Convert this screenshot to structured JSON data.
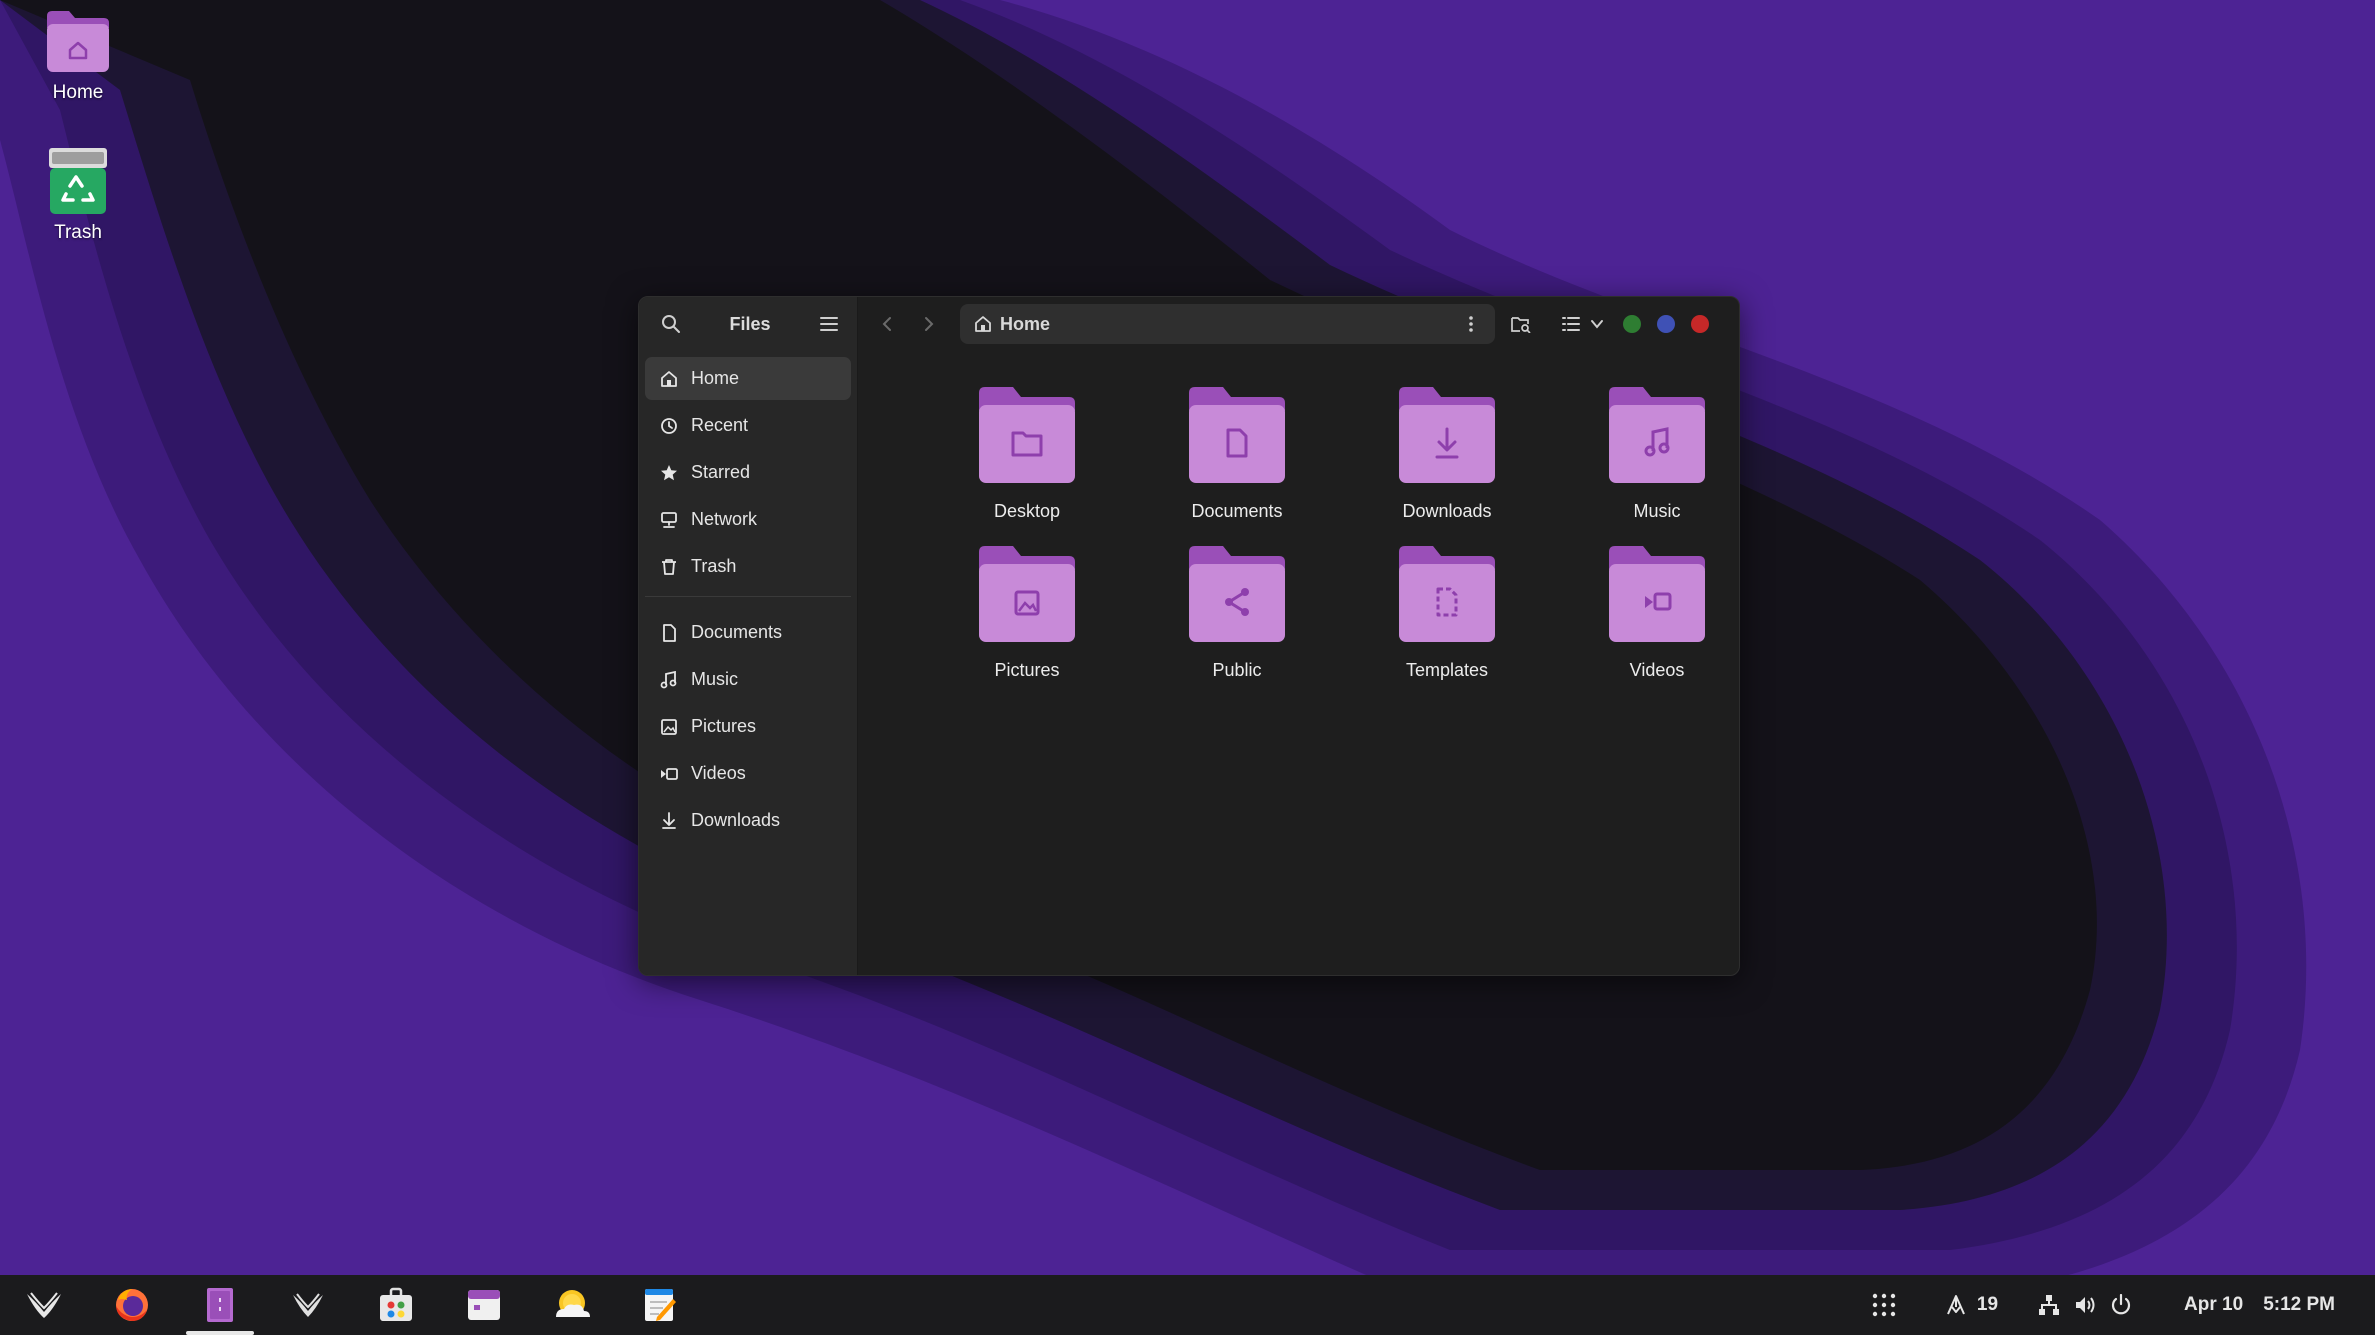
{
  "desktop": {
    "icons": [
      {
        "label": "Home",
        "icon": "home-folder-icon"
      },
      {
        "label": "Trash",
        "icon": "trash-icon"
      }
    ]
  },
  "window": {
    "sidebar": {
      "title": "Files",
      "places": [
        {
          "label": "Home",
          "icon": "home-icon",
          "active": true
        },
        {
          "label": "Recent",
          "icon": "clock-icon"
        },
        {
          "label": "Starred",
          "icon": "star-icon"
        },
        {
          "label": "Network",
          "icon": "network-icon"
        },
        {
          "label": "Trash",
          "icon": "trash-icon"
        }
      ],
      "bookmarks": [
        {
          "label": "Documents",
          "icon": "document-icon"
        },
        {
          "label": "Music",
          "icon": "music-icon"
        },
        {
          "label": "Pictures",
          "icon": "image-icon"
        },
        {
          "label": "Videos",
          "icon": "video-icon"
        },
        {
          "label": "Downloads",
          "icon": "download-icon"
        }
      ]
    },
    "path": {
      "label": "Home",
      "icon": "home-icon"
    },
    "folders": [
      {
        "label": "Desktop",
        "icon": "folder-glyph"
      },
      {
        "label": "Documents",
        "icon": "document-glyph"
      },
      {
        "label": "Downloads",
        "icon": "download-glyph"
      },
      {
        "label": "Music",
        "icon": "music-glyph"
      },
      {
        "label": "Pictures",
        "icon": "image-glyph"
      },
      {
        "label": "Public",
        "icon": "share-glyph"
      },
      {
        "label": "Templates",
        "icon": "template-glyph"
      },
      {
        "label": "Videos",
        "icon": "video-glyph"
      }
    ],
    "colors": {
      "folder_body": "#c88ad8",
      "folder_tab": "#9a4fb8",
      "glyph": "#8e3fac"
    },
    "window_controls": [
      {
        "name": "minimize",
        "color": "#2e7d32"
      },
      {
        "name": "maximize",
        "color": "#3f51b5"
      },
      {
        "name": "close",
        "color": "#c62828"
      }
    ]
  },
  "taskbar": {
    "apps": [
      "launcher",
      "firefox",
      "files",
      "zorin-connect",
      "software-store",
      "calendar",
      "weather",
      "text-editor"
    ],
    "active_app": "files",
    "tray": {
      "updates_count": "19",
      "date": "Apr 10",
      "time": "5:12 PM"
    }
  }
}
